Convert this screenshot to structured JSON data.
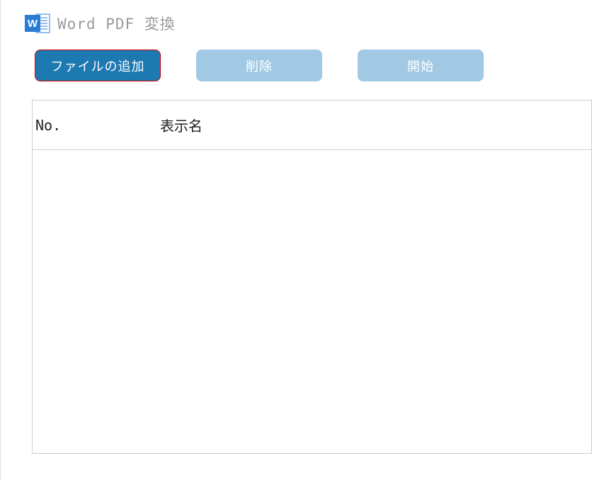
{
  "header": {
    "title": "Word PDF 変換"
  },
  "toolbar": {
    "add_file_label": "ファイルの追加",
    "delete_label": "削除",
    "start_label": "開始"
  },
  "table": {
    "columns": {
      "no": "No.",
      "name": "表示名"
    },
    "rows": []
  }
}
